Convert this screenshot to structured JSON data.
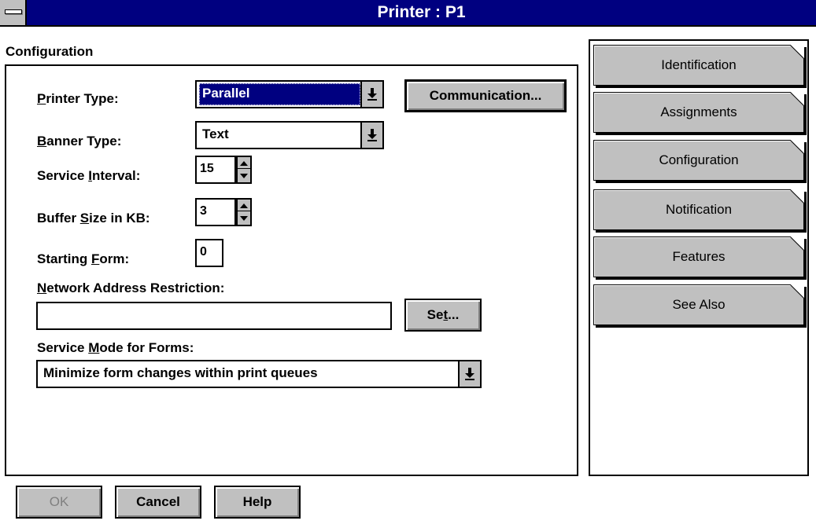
{
  "window": {
    "title": "Printer : P1"
  },
  "configuration": {
    "group_label": "Configuration",
    "printer_type": {
      "label": "Printer Type:",
      "value": "Parallel"
    },
    "communication_button": "Communication...",
    "banner_type": {
      "label": "Banner Type:",
      "value": "Text"
    },
    "service_interval": {
      "label": "Service Interval:",
      "value": "15"
    },
    "buffer_size": {
      "label": "Buffer Size in KB:",
      "value": "3"
    },
    "starting_form": {
      "label": "Starting Form:",
      "value": "0"
    },
    "network_address": {
      "label": "Network Address Restriction:",
      "value": ""
    },
    "set_button": "Set...",
    "service_mode": {
      "label": "Service Mode for Forms:",
      "value": "Minimize form changes within print queues"
    }
  },
  "buttons": {
    "ok": "OK",
    "cancel": "Cancel",
    "help": "Help"
  },
  "tabs": [
    {
      "label": "Identification"
    },
    {
      "label": "Assignments"
    },
    {
      "label": "Configuration",
      "active": true
    },
    {
      "label": "Notification"
    },
    {
      "label": "Features"
    },
    {
      "label": "See Also"
    }
  ],
  "icons": {
    "system_menu": "system-menu-icon",
    "dropdown": "dropdown-arrow-icon",
    "spinner": "spinner-icon"
  },
  "colors": {
    "titlebar": "#000080",
    "face": "#c0c0c0",
    "selection": "#000080"
  }
}
